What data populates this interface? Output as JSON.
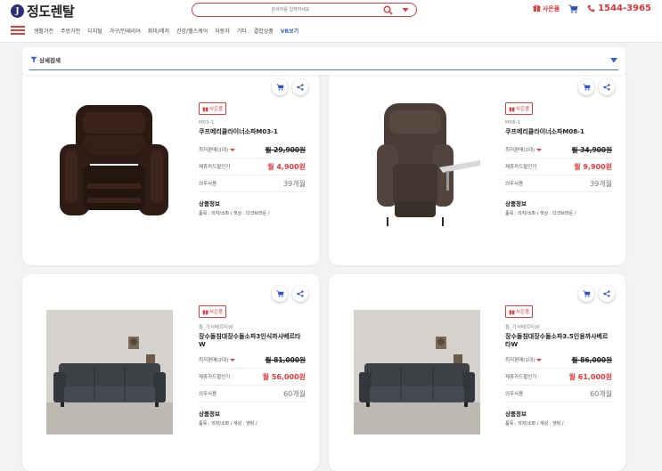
{
  "header": {
    "logo_mark": "J",
    "logo_text": "정도렌탈",
    "search_placeholder": "검색어를 입력하세요",
    "gift_link": "사은품",
    "phone": "1544-3965"
  },
  "nav": {
    "items": [
      "생활가전",
      "주방가전",
      "디지털",
      "가구/인테리어",
      "취미/레저",
      "건강/헬스케어",
      "자동차",
      "기타",
      "결합상품",
      "VR보기"
    ]
  },
  "filter": {
    "label": "상세검색"
  },
  "products": [
    {
      "badge": "사은품",
      "model": "M03-1",
      "name": "쿠프메리클라이너소파M03-1",
      "price_label": "최저판매(1대)",
      "price_orig": "월 29,900원",
      "card_label": "제휴카드할인가",
      "card_price": "월 4,900원",
      "duty_label": "의무사용",
      "duty_value": "39개월",
      "spec_title": "상품정보",
      "spec_text": "품목 : 의자/소파 / 색상 : 다크브라운 /"
    },
    {
      "badge": "사은품",
      "model": "M08-1",
      "name": "쿠프메리클라이너소파M08-1",
      "price_label": "최저판매(1대)",
      "price_orig": "월 34,900원",
      "card_label": "제휴카드할인가",
      "card_price": "월 9,900원",
      "duty_label": "의무사용",
      "duty_value": "39개월",
      "spec_title": "상품정보",
      "spec_text": "품목 : 의자/소파 / 색상 : 다크브라운 /"
    },
    {
      "badge": "사은품",
      "model": "돌_가서베르타W",
      "name": "장수돌침대장수돌소파3인식까사베르타W",
      "price_label": "최저판매(2대)",
      "price_orig": "월 81,000원",
      "card_label": "제휴카드할인가",
      "card_price": "월 56,000원",
      "duty_label": "의무사용",
      "duty_value": "60개월",
      "spec_title": "상품정보",
      "spec_text": "품목 : 의자/소파 / 색상 : 엔틱 /"
    },
    {
      "badge": "사은품",
      "model": "돌_가서베르타W",
      "name": "장수돌침대장수돌소파3.5인용까사베르타W",
      "price_label": "최저판매(1대)",
      "price_orig": "월 86,000원",
      "card_label": "제휴카드할인가",
      "card_price": "월 61,000원",
      "duty_label": "의무사용",
      "duty_value": "60개월",
      "spec_title": "상품정보",
      "spec_text": "품목 : 의자/소파 / 색상 : 엔틱 /"
    }
  ],
  "colors": {
    "accent_red": "#e23c3c",
    "logo_navy": "#2a2f78",
    "vr_blue": "#3561d6",
    "icon_blue": "#2f4fc7"
  }
}
